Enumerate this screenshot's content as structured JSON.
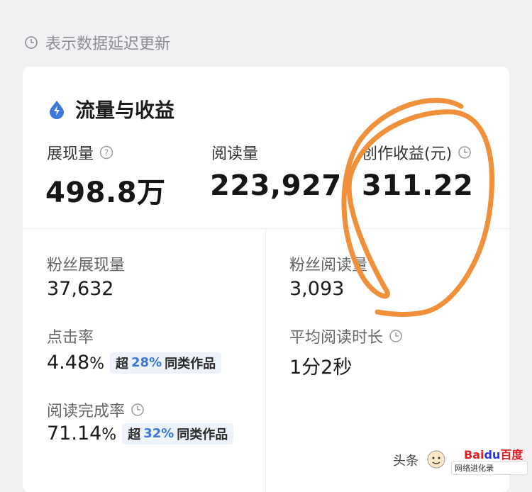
{
  "delay_note": "表示数据延迟更新",
  "card": {
    "title": "流量与收益",
    "metrics": [
      {
        "label": "展现量",
        "value": "498.8万"
      },
      {
        "label": "阅读量",
        "value": "223,927"
      },
      {
        "label": "创作收益(元)",
        "value": "311.22"
      }
    ],
    "fan_impressions": {
      "label": "粉丝展现量",
      "value": "37,632"
    },
    "fan_reads": {
      "label": "粉丝阅读量",
      "value": "3,093"
    },
    "ctr": {
      "label": "点击率",
      "value": "4.48",
      "unit": "%",
      "badge_prefix": "超",
      "badge_pct": "28%",
      "badge_suffix": "同类作品"
    },
    "avg_read_time": {
      "label": "平均阅读时长",
      "value": "1分2秒"
    },
    "completion": {
      "label": "阅读完成率",
      "value": "71.14",
      "unit": "%",
      "badge_prefix": "超",
      "badge_pct": "32%",
      "badge_suffix": "同类作品"
    }
  },
  "watermark": {
    "toutiao": "头条",
    "baidu_logo_left": "Bai",
    "baidu_logo_mid": "du",
    "baidu_logo_right": "百度",
    "baidu_search": "网络进化录"
  },
  "colors": {
    "accent_blue": "#3c78d8",
    "annotation_orange": "#f0903a",
    "background": "#f1f1f3"
  }
}
